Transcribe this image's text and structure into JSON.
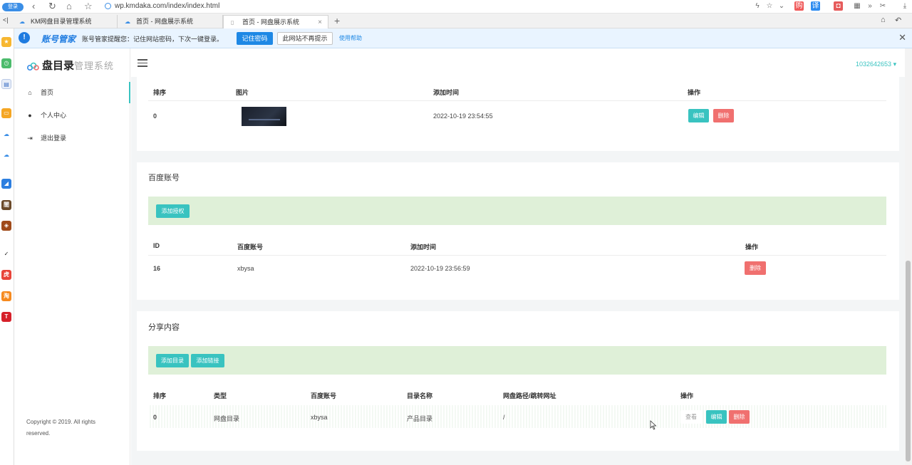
{
  "browser": {
    "login_label": "登录",
    "url": "wp.kmdaka.com/index/index.html",
    "tabs": [
      {
        "label": "KM网盘目录管理系统"
      },
      {
        "label": "首页 - 网盘展示系统"
      },
      {
        "label": "首页 - 网盘展示系统"
      }
    ],
    "new_tab": "+",
    "left_toggle": "<|"
  },
  "notify": {
    "brand": "账号管家",
    "message": "账号管家提醒您：记住网站密码，下次一键登录。",
    "remember_btn": "记住密码",
    "never_btn": "此网站不再提示",
    "help": "使用帮助",
    "close": "✕"
  },
  "app": {
    "logo_main": "盘目录",
    "logo_sub": "管理系统",
    "user": "1032642653",
    "menu": [
      {
        "label": "首页",
        "icon": "home-icon",
        "glyph": "⌂"
      },
      {
        "label": "个人中心",
        "icon": "user-icon",
        "glyph": "●"
      },
      {
        "label": "退出登录",
        "icon": "logout-icon",
        "glyph": "⇥"
      }
    ],
    "copyright": "Copyright © 2019. All rights reserved."
  },
  "images": {
    "headers": [
      "排序",
      "图片",
      "添加时间",
      "操作"
    ],
    "row": {
      "order": "0",
      "time": "2022-10-19 23:54:55",
      "edit": "编辑",
      "delete": "删除"
    }
  },
  "baidu": {
    "title": "百度账号",
    "add_btn": "添加授权",
    "headers": [
      "ID",
      "百度账号",
      "添加时间",
      "操作"
    ],
    "row": {
      "id": "16",
      "account": "xbysa",
      "time": "2022-10-19 23:56:59",
      "delete": "删除"
    }
  },
  "share": {
    "title": "分享内容",
    "add_dir_btn": "添加目录",
    "add_link_btn": "添加链接",
    "headers": [
      "排序",
      "类型",
      "百度账号",
      "目录名称",
      "网盘路径/跳转网址",
      "操作"
    ],
    "row": {
      "order": "0",
      "type": "网盘目录",
      "account": "xbysa",
      "name": "产品目录",
      "path": "/",
      "view": "查看",
      "edit": "编辑",
      "delete": "删除"
    }
  },
  "colors": {
    "accent": "#39c3c0",
    "danger": "#f0706f",
    "success_bg": "#dff0d8"
  }
}
